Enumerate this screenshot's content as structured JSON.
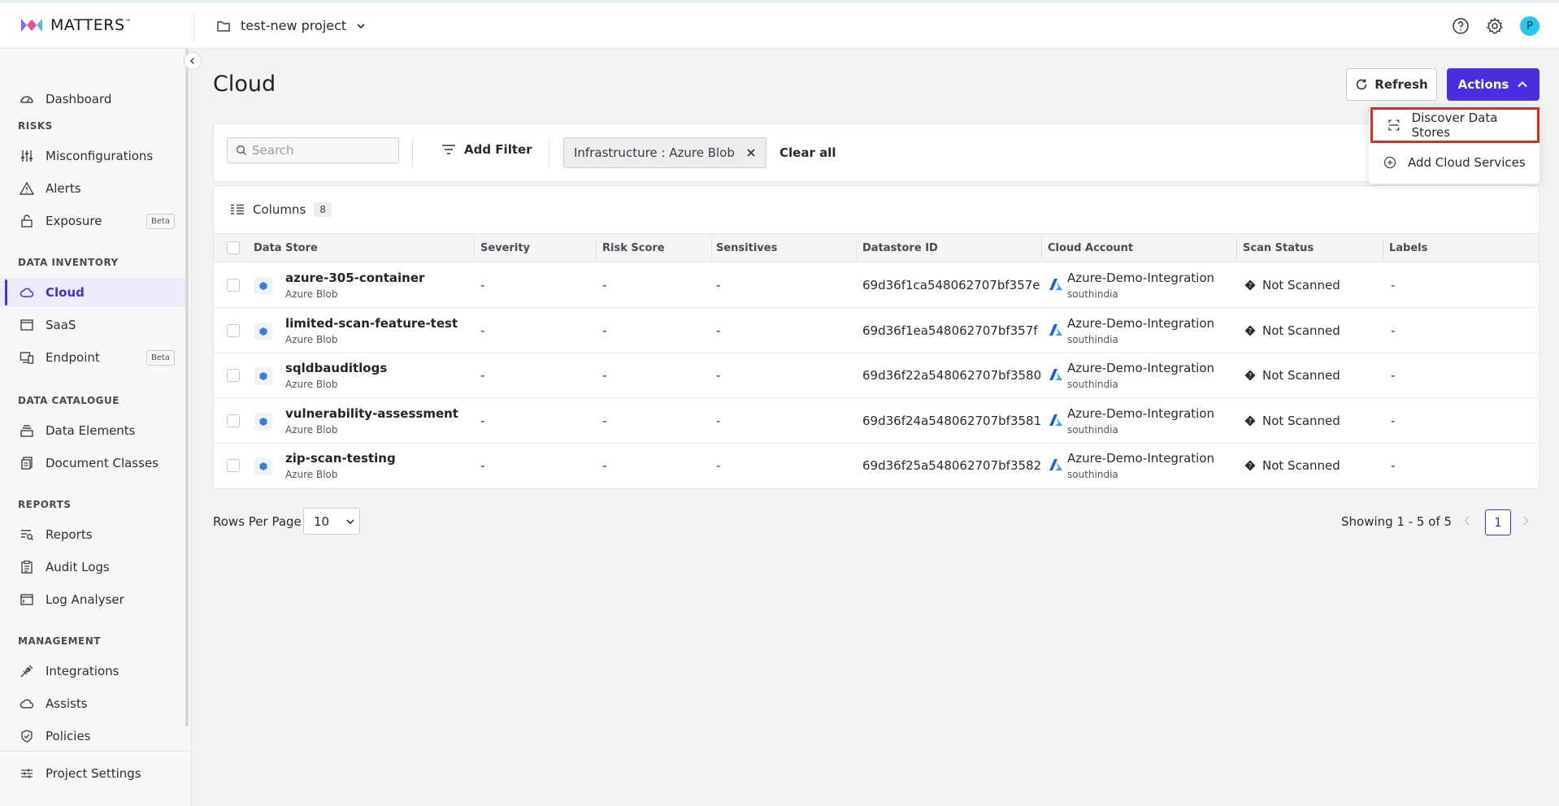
{
  "app": {
    "logo_text": "MATTERS",
    "logo_tm": "™",
    "project_name": "test-new project",
    "user_initial": "P"
  },
  "sidebar": {
    "dashboard": "Dashboard",
    "sections": {
      "risks": "RISKS",
      "data_inventory": "DATA INVENTORY",
      "data_catalogue": "DATA CATALOGUE",
      "reports": "REPORTS",
      "management": "MANAGEMENT"
    },
    "items": {
      "misconfigurations": "Misconfigurations",
      "alerts": "Alerts",
      "exposure": "Exposure",
      "cloud": "Cloud",
      "saas": "SaaS",
      "endpoint": "Endpoint",
      "data_elements": "Data Elements",
      "document_classes": "Document Classes",
      "reports": "Reports",
      "audit_logs": "Audit Logs",
      "log_analyser": "Log Analyser",
      "integrations": "Integrations",
      "assists": "Assists",
      "policies": "Policies",
      "project_settings": "Project Settings"
    },
    "beta_label": "Beta"
  },
  "page": {
    "title": "Cloud",
    "refresh_label": "Refresh",
    "actions_label": "Actions"
  },
  "actions_menu": {
    "discover": "Discover Data Stores",
    "add_cloud": "Add Cloud Services"
  },
  "filters": {
    "search_placeholder": "Search",
    "add_filter_label": "Add Filter",
    "chip_label": "Infrastructure : Azure Blob",
    "clear_all": "Clear all"
  },
  "table": {
    "columns_label": "Columns",
    "columns_count": "8",
    "headers": {
      "data_store": "Data Store",
      "severity": "Severity",
      "risk_score": "Risk Score",
      "sensitives": "Sensitives",
      "datastore_id": "Datastore ID",
      "cloud_account": "Cloud Account",
      "scan_status": "Scan Status",
      "labels": "Labels"
    },
    "rows": [
      {
        "name": "azure-305-container",
        "type": "Azure Blob",
        "severity": "-",
        "risk": "-",
        "sensitives": "-",
        "id": "69d36f1ca548062707bf357e",
        "account": "Azure-Demo-Integration",
        "region": "southindia",
        "scan": "Not Scanned",
        "labels": "-"
      },
      {
        "name": "limited-scan-feature-test",
        "type": "Azure Blob",
        "severity": "-",
        "risk": "-",
        "sensitives": "-",
        "id": "69d36f1ea548062707bf357f",
        "account": "Azure-Demo-Integration",
        "region": "southindia",
        "scan": "Not Scanned",
        "labels": "-"
      },
      {
        "name": "sqldbauditlogs",
        "type": "Azure Blob",
        "severity": "-",
        "risk": "-",
        "sensitives": "-",
        "id": "69d36f22a548062707bf3580",
        "account": "Azure-Demo-Integration",
        "region": "southindia",
        "scan": "Not Scanned",
        "labels": "-"
      },
      {
        "name": "vulnerability-assessment",
        "type": "Azure Blob",
        "severity": "-",
        "risk": "-",
        "sensitives": "-",
        "id": "69d36f24a548062707bf3581",
        "account": "Azure-Demo-Integration",
        "region": "southindia",
        "scan": "Not Scanned",
        "labels": "-"
      },
      {
        "name": "zip-scan-testing",
        "type": "Azure Blob",
        "severity": "-",
        "risk": "-",
        "sensitives": "-",
        "id": "69d36f25a548062707bf3582",
        "account": "Azure-Demo-Integration",
        "region": "southindia",
        "scan": "Not Scanned",
        "labels": "-"
      }
    ]
  },
  "pagination": {
    "rows_per_page_label": "Rows Per Page",
    "rows_per_page_value": "10",
    "showing": "Showing 1 - 5 of 5",
    "current_page": "1"
  },
  "colors": {
    "accent": "#4a2ee0",
    "highlight_border": "#d22f27",
    "avatar": "#22c9e8"
  }
}
